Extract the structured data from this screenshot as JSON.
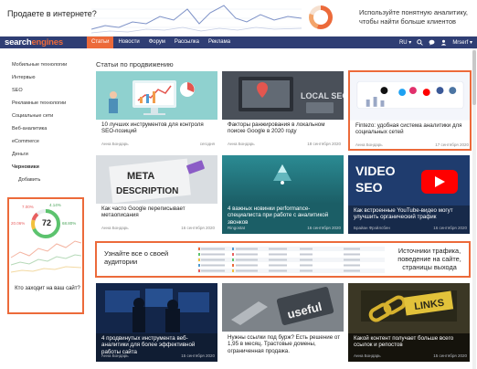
{
  "promo": {
    "left_text": "Продаете в интернете?",
    "right_text": "Используйте понятную аналитику, чтобы найти больше клиентов"
  },
  "navbar": {
    "logo_a": "search",
    "logo_b": "engines",
    "items": [
      "Статьи",
      "Новости",
      "Форум",
      "Рассылка",
      "Реклама"
    ],
    "active_index": 0,
    "lang": "RU",
    "user": "Mrserf",
    "icons": [
      "search-icon",
      "comment-icon",
      "user-icon"
    ],
    "colors": {
      "bar": "#2f3e74",
      "accent": "#ec6a3a"
    }
  },
  "sidebar": {
    "items": [
      {
        "label": "Мобильные технологии"
      },
      {
        "label": "Интервью"
      },
      {
        "label": "SEO"
      },
      {
        "label": "Рекламные технологии"
      },
      {
        "label": "Социальные сети"
      },
      {
        "label": "Веб-аналитика"
      },
      {
        "label": "eCommerce"
      },
      {
        "label": "Деньги"
      },
      {
        "label": "Черновики"
      },
      {
        "label": "Добавить"
      }
    ]
  },
  "widget": {
    "score": "72",
    "p1": "7.00%",
    "p2": "4.14%",
    "p3": "20.06%",
    "p4": "68.80%",
    "title": "Кто заходит на ваш сайт?"
  },
  "main": {
    "title": "Статьи по продвижению",
    "cards": [
      {
        "title": "10 лучших инструментов для контроля SEO-позиций",
        "author": "Анна Бондарь",
        "date": "сегодня"
      },
      {
        "title": "Факторы ранжирования в локальном поиске Google в 2020 году",
        "author": "Анна Бондарь",
        "date": "18 сентября 2020"
      },
      {
        "title": "Fintezo: удобная система аналитики для социальных сетей",
        "author": "Анна Бондарь",
        "date": "17 сентября 2020"
      },
      {
        "title": "Как часто Google переписывает метаописания",
        "author": "Анна Бондарь",
        "date": "16 сентября 2020"
      },
      {
        "title": "4 важных новинки performance-специалиста при работе с аналитикой звонков",
        "author": "Ringostat",
        "date": "16 сентября 2020"
      },
      {
        "title": "Как встроенные YouTube-видео могут улучшить органический трафик",
        "author": "Брайан Фрэйлсбен",
        "date": "16 сентября 2020"
      },
      {
        "title": "4 продвинутых инструмента веб-аналитики для более эффективной работы сайта",
        "author": "Анна Бондарь",
        "date": "15 сентября 2020"
      },
      {
        "title": "Нужны ссылки под бурж? Есть решение от 1,95 в месяц. Трастовые домены, ограниченная продажа.",
        "author": "",
        "date": ""
      },
      {
        "title": "Какой контент получает больше всего ссылок и репостов",
        "author": "Анна Бондарь",
        "date": "15 сентября 2020"
      }
    ],
    "image_text": {
      "c2": "LOCAL SEO",
      "c4a": "META",
      "c4b": "DESCRIPTION",
      "c6a": "VIDEO",
      "c6b": "SEO",
      "c8": "useful",
      "c9": "LINKS"
    },
    "band": {
      "left": "Узнайте все о своей аудитории",
      "right": "Источники трафика, поведение на сайте, страницы выхода"
    }
  }
}
